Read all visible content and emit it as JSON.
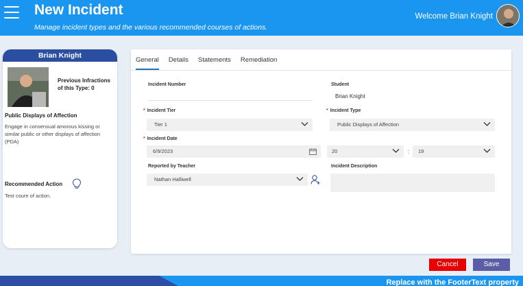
{
  "header": {
    "title": "New Incident",
    "subtitle": "Manage incident types and the various recommended courses of actions.",
    "welcome": "Welcome Brian Knight",
    "accent_color": "#1a96f0"
  },
  "student_card": {
    "name": "Brian Knight",
    "previous_infractions": "Previous Infractions of this Type: 0",
    "infraction_type": "Public Displays of Affection",
    "infraction_description": "Engage in consensual amorous kissing or similar public or other displays of affection (PDA)",
    "recommended_action_label": "Recommended Action",
    "recommended_action_text": "Test coure of action.",
    "header_color": "#2a4fa0"
  },
  "tabs": [
    {
      "label": "General",
      "active": true
    },
    {
      "label": "Details",
      "active": false
    },
    {
      "label": "Statements",
      "active": false
    },
    {
      "label": "Remediation",
      "active": false
    }
  ],
  "form": {
    "incident_number": {
      "label": "Incident Number",
      "value": ""
    },
    "student": {
      "label": "Student",
      "value": "Brian Knight"
    },
    "incident_tier": {
      "label": "Incident Tier",
      "value": "Tier 1",
      "required": true
    },
    "incident_type": {
      "label": "Incident Type",
      "value": "Public Displays of Affection",
      "required": true
    },
    "incident_date": {
      "label": "Incident Date",
      "value": "6/9/2023",
      "hour": "20",
      "minute": "19",
      "required": true
    },
    "reported_by": {
      "label": "Reported by Teacher",
      "value": "Nathan Halliwell"
    },
    "description": {
      "label": "Incident Description",
      "value": ""
    }
  },
  "buttons": {
    "cancel": "Cancel",
    "save": "Save",
    "cancel_color": "#e80000",
    "save_color": "#5b5ea6"
  },
  "footer": {
    "text": "Replace with the FooterText property"
  },
  "icons": [
    "menu-icon",
    "calendar-icon",
    "chevron-down-icon",
    "add-person-icon",
    "lightbulb-icon"
  ]
}
